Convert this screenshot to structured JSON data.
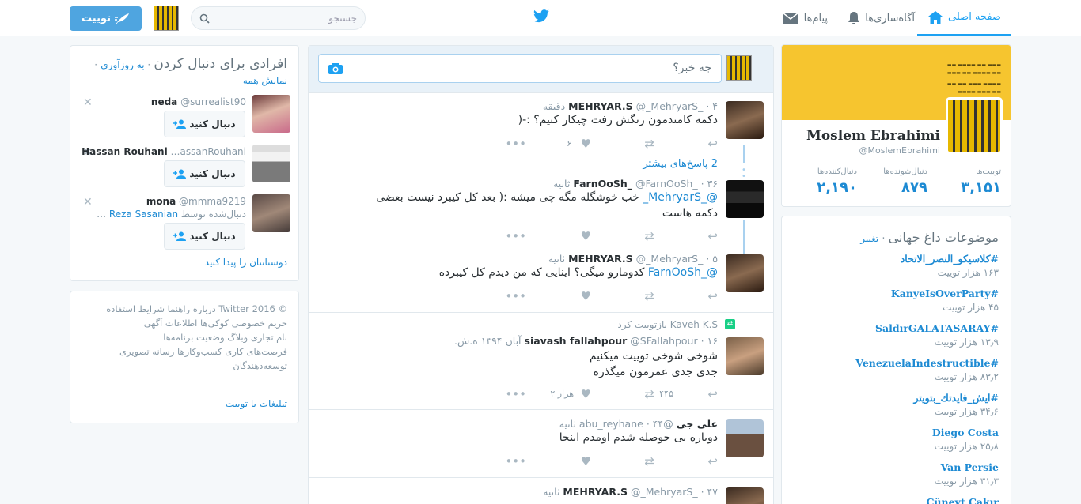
{
  "nav": {
    "home": "صفحه اصلی",
    "notifications": "آگاه‌سازی‌ها",
    "messages": "پیام‌ها",
    "search_placeholder": "جستجو",
    "tweet_button": "توییت"
  },
  "who_to_follow": {
    "title": "افرادی برای دنبال کردن",
    "refresh": "به روزآوری",
    "view_all": "نمایش همه",
    "follow_label": "دنبال کنید",
    "find_friends": "دوستانتان را پیدا کنید",
    "people": [
      {
        "name": "neda",
        "handle": "@surrealist90",
        "note": ""
      },
      {
        "name": "Hassan Rouhani",
        "handle": "…assanRouhani",
        "note": ""
      },
      {
        "name": "mona",
        "handle": "@mmma9219",
        "note": "دنبال‌شده توسط",
        "note_link": "Reza Sasanian",
        "note_suffix": "…"
      }
    ]
  },
  "footer": {
    "lines": [
      "© 2016 Twitter  درباره  راهنما  شرایط استفاده",
      "حریم خصوصی  کوکی‌ها  اطلاعات آگهی",
      "نام تجاری  وبلاگ  وضعیت  برنامه‌ها",
      "فرصت‌های کاری  کسب‌وکارها  رسانه تصویری",
      "توسعه‌دهندگان"
    ],
    "ads": "تبلیغات با توییت"
  },
  "composer": {
    "placeholder": "چه خبر؟"
  },
  "tweets": [
    {
      "name": "MEHRYAR.S",
      "handle": "@_MehryarS_",
      "time": "۴ دقیقه",
      "text": "دکمه کامندمون رنگش رفت چیکار کنیم؟ :-(",
      "likes": "۶",
      "retweets": ""
    },
    {
      "more_replies": "2 پاسخ‌های بیشتر"
    },
    {
      "name": "FarnOoSh_",
      "handle": "@FarnOoSh_",
      "time": "۳۶ ثانیه",
      "mention": "@_MehryarS_",
      "text": "خب خوشگله مگه چی میشه :( بعد کل کیبرد نیست بعضی دکمه هاست"
    },
    {
      "name": "MEHRYAR.S",
      "handle": "@_MehryarS_",
      "time": "۵ ثانیه",
      "mention": "@_FarnOoSh",
      "text": "کدومارو میگی؟ اینایی که من دیدم کل کیبرده"
    },
    {
      "retweeted_by": "Kaveh K.S بازتوییت کرد",
      "name": "siavash fallahpour",
      "handle": "@SFallahpour",
      "time": "۱۶ آبان ۱۳۹۴ ه.ش.",
      "text": "شوخی شوخی توییت میکنیم\nجدی جدی عمرمون میگذره",
      "retweets": "۴۴۵",
      "likes": "۲ هزار"
    },
    {
      "name": "علی جی",
      "handle": "@abu_reyhane",
      "time": "۴۴ ثانیه",
      "text": "دوباره بی حوصله شدم اومدم اینجا"
    },
    {
      "name": "MEHRYAR.S",
      "handle": "@_MehryarS_",
      "time": "۴۷ ثانیه",
      "text": ""
    }
  ],
  "profile": {
    "name": "Moslem Ebrahimi",
    "handle": "@MoslemEbrahimi",
    "stats": [
      {
        "label": "توییت‌ها",
        "value": "۳,۱۵۱"
      },
      {
        "label": "دنبال‌شونده‌ها",
        "value": "۸۷۹"
      },
      {
        "label": "دنبال‌کننده‌ها",
        "value": "۲,۱۹۰"
      }
    ]
  },
  "trends": {
    "title": "موضوعات داغ جهانی",
    "change": "تغییر",
    "items": [
      {
        "tag": "#كلاسيكو_النصر_الاتحاد",
        "count": "۱۶۳ هزار توییت"
      },
      {
        "tag": "#KanyeIsOverParty",
        "count": "۴۵ هزار توییت"
      },
      {
        "tag": "#SaldırGALATASARAY",
        "count": "۱۳٫۹ هزار توییت"
      },
      {
        "tag": "#VenezuelaIndestructible",
        "count": "۸۳٫۲ هزار توییت"
      },
      {
        "tag": "#ايش_فايدتك_بتويتر",
        "count": "۳۴٫۶ هزار توییت"
      },
      {
        "tag": "Diego Costa",
        "count": "۲۵٫۸ هزار توییت"
      },
      {
        "tag": "Van Persie",
        "count": "۳۱٫۳ هزار توییت"
      },
      {
        "tag": "Cüneyt Çakır",
        "count": ""
      }
    ]
  },
  "colors": {
    "accent": "#1da1f2",
    "link": "#1d8ad3",
    "background": "#f5f8fa",
    "banner": "#f6c52f"
  }
}
